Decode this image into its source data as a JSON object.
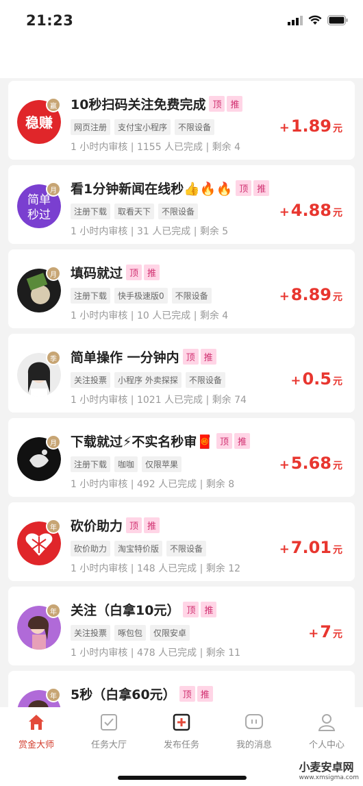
{
  "status": {
    "time": "21:23"
  },
  "tasks": [
    {
      "avatar_text": "稳赚",
      "badge": "赢",
      "title": "10秒扫码关注免费完成",
      "tags": [
        "网页注册",
        "支付宝小程序",
        "不限设备"
      ],
      "meta": "1 小时内审核 | 1155 人已完成 | 剩余 4",
      "price": "1.89"
    },
    {
      "avatar_text": "简单秒过",
      "badge": "月",
      "title": "看1分钟新闻在线秒👍🔥🔥",
      "tags": [
        "注册下载",
        "取看天下",
        "不限设备"
      ],
      "meta": "1 小时内审核 | 31 人已完成 | 剩余 5",
      "price": "4.88"
    },
    {
      "avatar_text": "",
      "badge": "月",
      "title": "填码就过",
      "tags": [
        "注册下载",
        "快手极速版0",
        "不限设备"
      ],
      "meta": "1 小时内审核 | 10 人已完成 | 剩余 4",
      "price": "8.89"
    },
    {
      "avatar_text": "",
      "badge": "季",
      "title": "简单操作 一分钟内",
      "tags": [
        "关注投票",
        "小程序 外卖探探",
        "不限设备"
      ],
      "meta": "1 小时内审核 | 1021 人已完成 | 剩余 74",
      "price": "0.5"
    },
    {
      "avatar_text": "",
      "badge": "月",
      "title": "下载就过⚡不实名秒审🧧",
      "tags": [
        "注册下载",
        "咖咖",
        "仅限苹果"
      ],
      "meta": "1 小时内审核 | 492 人已完成 | 剩余 8",
      "price": "5.68"
    },
    {
      "avatar_text": "",
      "badge": "年",
      "title": "砍价助力",
      "tags": [
        "砍价助力",
        "淘宝特价版",
        "不限设备"
      ],
      "meta": "1 小时内审核 | 148 人已完成 | 剩余 12",
      "price": "7.01"
    },
    {
      "avatar_text": "",
      "badge": "年",
      "title": "关注（白拿10元）",
      "tags": [
        "关注投票",
        "啄包包",
        "仅限安卓"
      ],
      "meta": "1 小时内审核 | 478 人已完成 | 剩余 11",
      "price": "7"
    },
    {
      "avatar_text": "",
      "badge": "年",
      "title": "5秒（白拿60元）",
      "tags": [],
      "meta": "",
      "price": ""
    }
  ],
  "tag_top": "顶",
  "tag_rec": "推",
  "price_plus": "+",
  "price_unit": "元",
  "nav": [
    {
      "label": "赏金大师",
      "icon": "home-icon"
    },
    {
      "label": "任务大厅",
      "icon": "task-check-icon"
    },
    {
      "label": "发布任务",
      "icon": "publish-plus-icon"
    },
    {
      "label": "我的消息",
      "icon": "message-icon"
    },
    {
      "label": "个人中心",
      "icon": "profile-icon"
    }
  ],
  "watermark": {
    "title": "小麦安卓网",
    "url": "www.xmsigma.com"
  },
  "colors": {
    "accent": "#d23a2a",
    "price": "#e8362f",
    "tag_bg": "#ffd5e6"
  }
}
